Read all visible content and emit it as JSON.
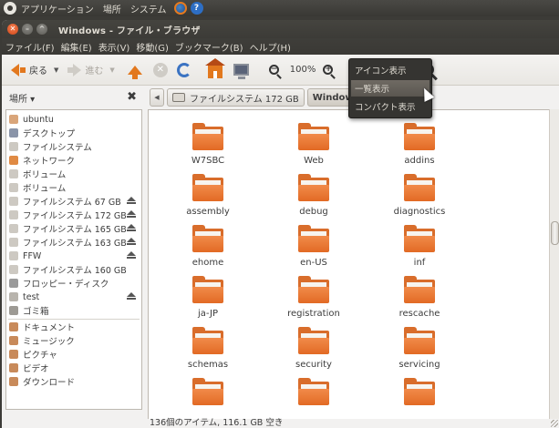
{
  "panel": {
    "menus": [
      "アプリケーション",
      "場所",
      "システム"
    ]
  },
  "window": {
    "title": "Windows - ファイル・ブラウザ"
  },
  "menubar": {
    "items": [
      "ファイル(F)",
      "編集(E)",
      "表示(V)",
      "移動(G)",
      "ブックマーク(B)",
      "ヘルプ(H)"
    ]
  },
  "toolbar": {
    "back_label": "戻る",
    "forward_label": "進む",
    "zoom_level": "100%"
  },
  "view_menu": {
    "items": [
      "アイコン表示",
      "一覧表示",
      "コンパクト表示"
    ],
    "highlighted": "一覧表示"
  },
  "sidebar": {
    "title": "場所",
    "items": [
      {
        "label": "ubuntu",
        "icon": "home-folder-icon",
        "color": "#d9a57a"
      },
      {
        "label": "デスクトップ",
        "icon": "desktop-icon",
        "color": "#8a94a8"
      },
      {
        "label": "ファイルシステム",
        "icon": "drive-icon",
        "color": "#cdc9c2"
      },
      {
        "label": "ネットワーク",
        "icon": "network-icon",
        "color": "#e08a43"
      },
      {
        "label": "ボリューム",
        "icon": "drive-icon",
        "color": "#cdc9c2"
      },
      {
        "label": "ボリューム",
        "icon": "drive-icon",
        "color": "#cdc9c2"
      },
      {
        "label": "ファイルシステム 67 GB",
        "icon": "drive-icon",
        "color": "#cdc9c2",
        "eject": true
      },
      {
        "label": "ファイルシステム 172 GB",
        "icon": "drive-icon",
        "color": "#cdc9c2",
        "eject": true
      },
      {
        "label": "ファイルシステム 165 GB",
        "icon": "drive-icon",
        "color": "#cdc9c2",
        "eject": true
      },
      {
        "label": "ファイルシステム 163 GB",
        "icon": "drive-icon",
        "color": "#cdc9c2",
        "eject": true
      },
      {
        "label": "FFW",
        "icon": "drive-icon",
        "color": "#cdc9c2",
        "eject": true
      },
      {
        "label": "ファイルシステム 160 GB",
        "icon": "drive-icon",
        "color": "#cdc9c2"
      },
      {
        "label": "フロッピー・ディスク",
        "icon": "floppy-icon",
        "color": "#9a9a9a"
      },
      {
        "label": "test",
        "icon": "usb-drive-icon",
        "color": "#b8b4ad",
        "eject": true
      },
      {
        "label": "ゴミ箱",
        "icon": "trash-icon",
        "color": "#9d9a94"
      },
      {
        "label": "ドキュメント",
        "icon": "documents-folder-icon",
        "color": "#c88a5a"
      },
      {
        "label": "ミュージック",
        "icon": "music-folder-icon",
        "color": "#c88a5a"
      },
      {
        "label": "ピクチャ",
        "icon": "pictures-folder-icon",
        "color": "#c88a5a"
      },
      {
        "label": "ビデオ",
        "icon": "videos-folder-icon",
        "color": "#c88a5a"
      },
      {
        "label": "ダウンロード",
        "icon": "downloads-folder-icon",
        "color": "#c88a5a"
      }
    ]
  },
  "pathbar": {
    "segments": [
      "ファイルシステム 172 GB",
      "Windows"
    ]
  },
  "folders": [
    "W7SBC",
    "Web",
    "addins",
    "assembly",
    "debug",
    "diagnostics",
    "ehome",
    "en-US",
    "inf",
    "ja-JP",
    "registration",
    "rescache",
    "schemas",
    "security",
    "servicing",
    "",
    "",
    ""
  ],
  "status": {
    "text": "136個のアイテム, 116.1 GB 空き"
  },
  "colors": {
    "accent": "#e2781e",
    "folder": "#e26a24",
    "panel_bg": "#3c3b37"
  }
}
